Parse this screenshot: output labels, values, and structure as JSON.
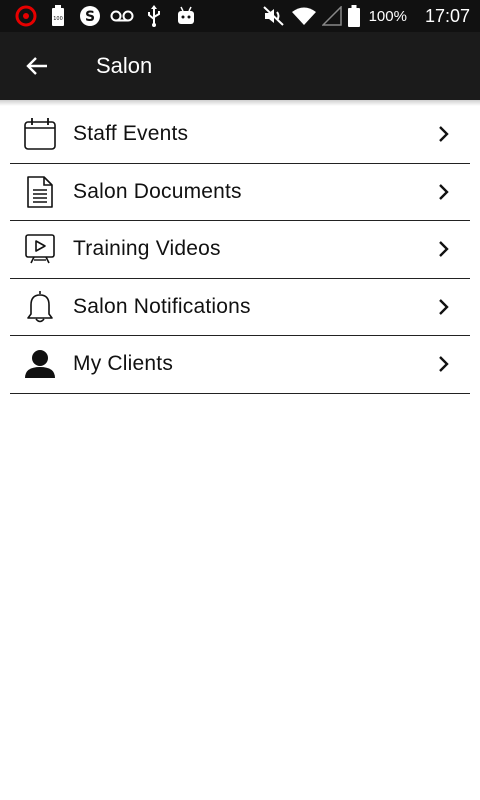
{
  "status_bar": {
    "icons_left": [
      "vodafone-icon",
      "battery-100-icon",
      "skype-icon",
      "voicemail-icon",
      "usb-icon",
      "android-debug-icon"
    ],
    "icons_right": [
      "mute-icon",
      "wifi-icon",
      "signal-icon",
      "battery-icon"
    ],
    "battery_percent": "100%",
    "time": "17:07"
  },
  "app_bar": {
    "title": "Salon",
    "back_icon": "arrow-left-icon"
  },
  "menu": {
    "items": [
      {
        "label": "Staff Events",
        "icon": "calendar-icon"
      },
      {
        "label": "Salon Documents",
        "icon": "document-icon"
      },
      {
        "label": "Training Videos",
        "icon": "video-icon"
      },
      {
        "label": "Salon Notifications",
        "icon": "bell-icon"
      },
      {
        "label": "My Clients",
        "icon": "person-icon"
      }
    ]
  },
  "colors": {
    "app_bar": "#1b1b1b",
    "status_bar": "#111111",
    "divider": "#222222",
    "text": "#111111"
  }
}
